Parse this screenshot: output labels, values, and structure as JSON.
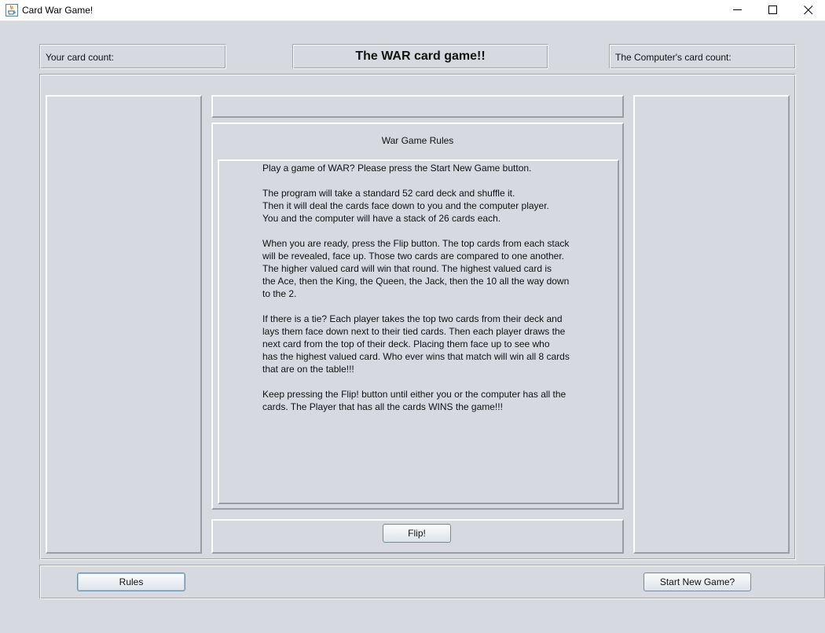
{
  "window": {
    "title": "Card War Game!"
  },
  "header": {
    "your_count_label": "Your card count:",
    "game_title": "The WAR card game!!",
    "computer_count_label": "The Computer's card count:"
  },
  "rules_panel": {
    "heading": "War Game Rules",
    "paragraphs": [
      "Play a game of WAR? Please press the Start New Game button.",
      "The program will take a standard 52 card deck and shuffle it.\nThen it will deal the cards face down to you and the computer player.\nYou and the computer will have a stack of 26 cards each.",
      "When you are ready, press the Flip button. The top cards from each stack\nwill be revealed, face up. Those two cards are compared to one another.\nThe higher valued card will win that round. The highest valued card is\nthe Ace, then the King, the Queen, the Jack, then the 10 all the way down\nto the 2.",
      "If there is a tie? Each player takes the top two cards from their deck and\nlays them face down next to their tied cards. Then each player draws the\nnext card from the top of their deck. Placing them face up to see who\nhas the highest valued card. Who ever wins that match will win all 8 cards\nthat are on the table!!!",
      "Keep pressing the Flip! button until either you or the computer has all the\ncards. The Player that has all the cards WINS the game!!!"
    ]
  },
  "buttons": {
    "flip": "Flip!",
    "rules": "Rules",
    "start_new_game": "Start New Game?"
  },
  "icons": {
    "app": "java-coffee-cup-icon",
    "minimize": "minimize-icon",
    "maximize": "maximize-icon",
    "close": "close-icon"
  },
  "colors": {
    "background": "#d6d9df",
    "titlebar": "#ffffff",
    "java_orange": "#e76f00",
    "java_blue": "#5382a1"
  }
}
